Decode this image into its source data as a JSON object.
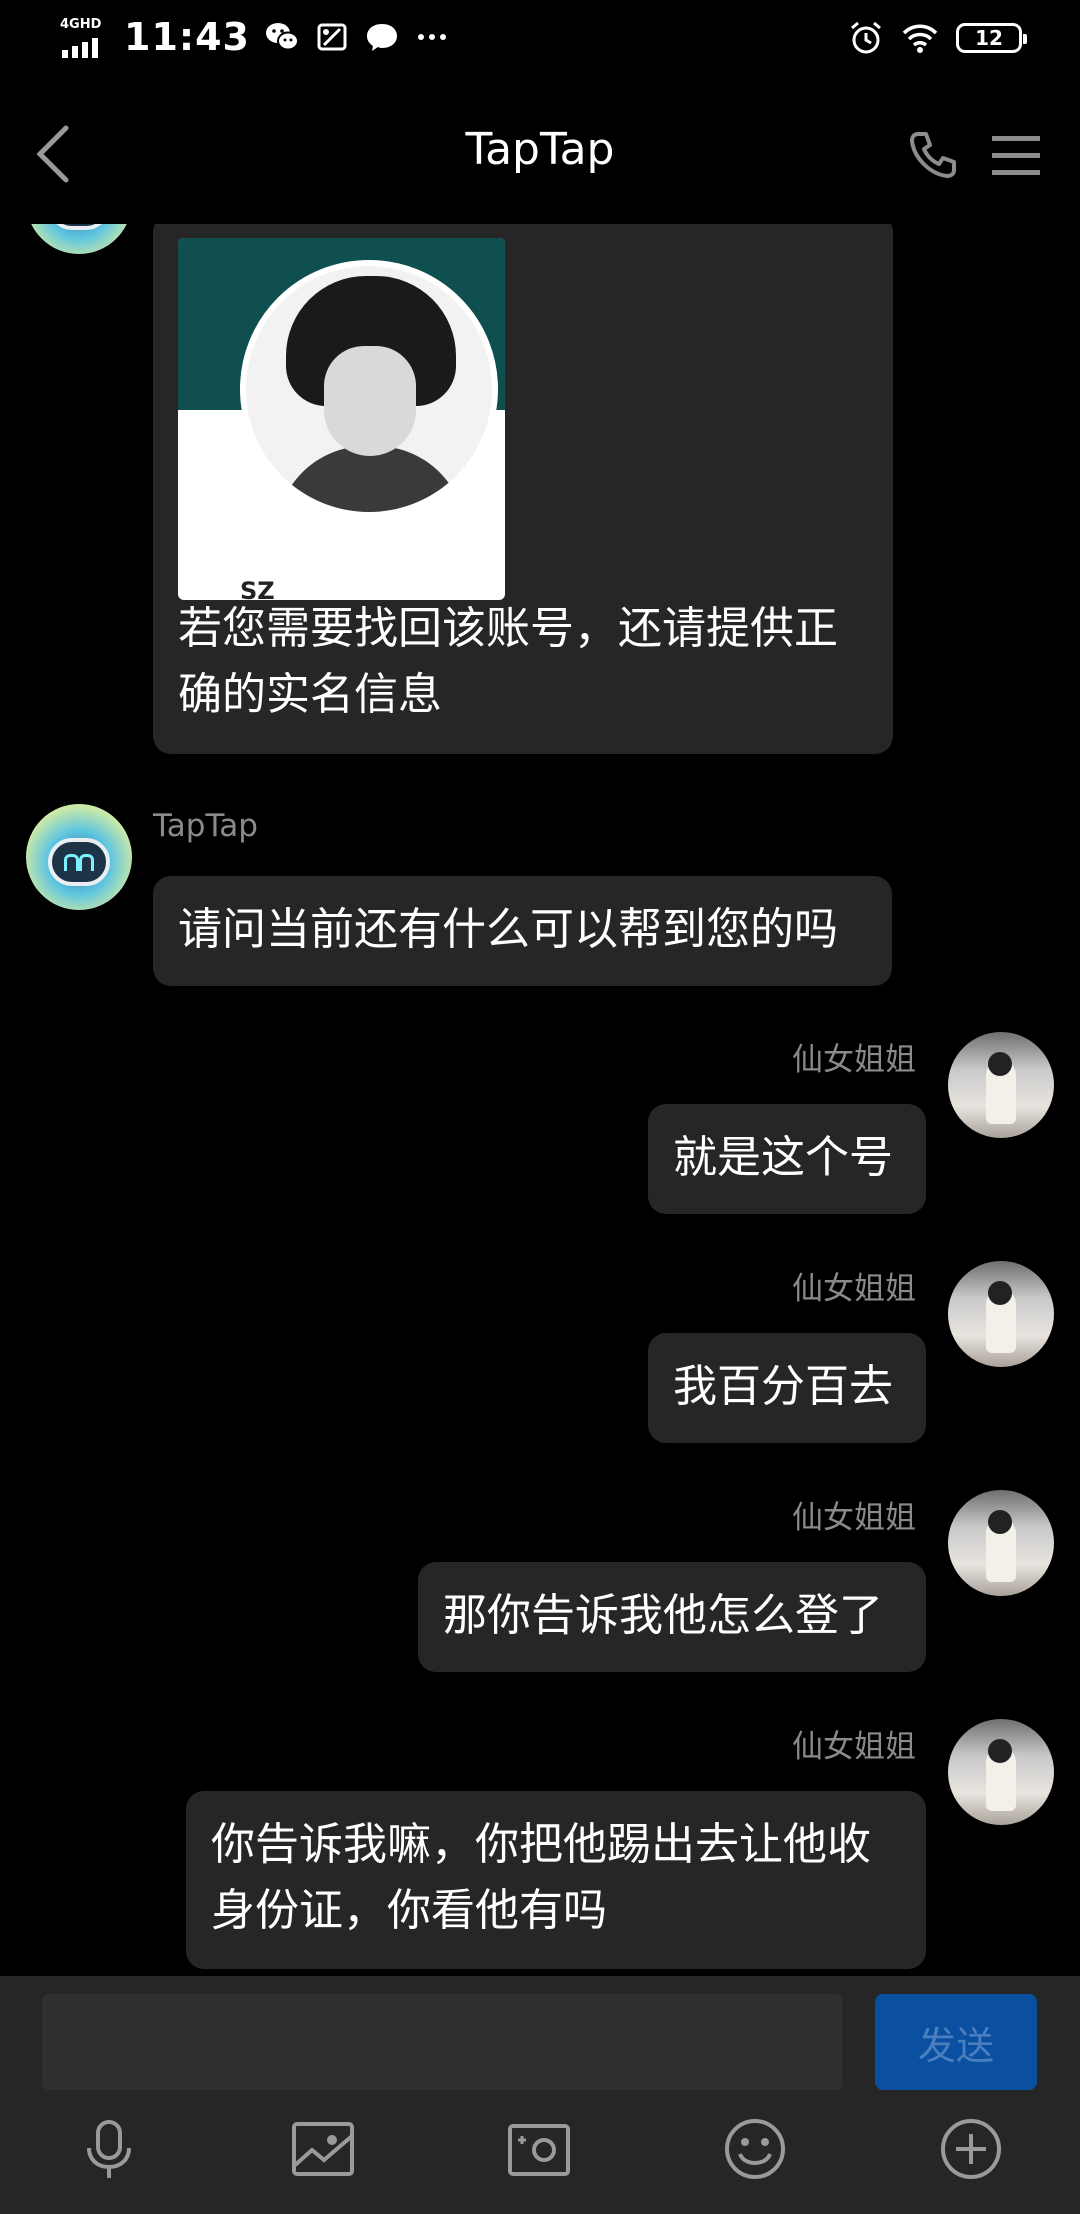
{
  "status_bar": {
    "network": "4GHD",
    "time": "11:43",
    "battery": "12",
    "icons": [
      "wechat-icon",
      "screenshot-icon",
      "message-icon",
      "more-dots-icon",
      "alarm-icon",
      "wifi-icon",
      "battery-icon"
    ]
  },
  "nav": {
    "title": "TapTap",
    "icons": [
      "back-arrow-icon",
      "phone-icon",
      "menu-icon"
    ]
  },
  "messages": [
    {
      "side": "left",
      "type": "image_text",
      "image_label": "SZ",
      "text_lines": [
        "若您需要找回该账号，还请提供正",
        "确的实名信息"
      ]
    },
    {
      "side": "left",
      "type": "text",
      "sender": "TapTap",
      "text_lines": [
        "请问当前还有什么可以帮到您的吗"
      ]
    },
    {
      "side": "right",
      "type": "text",
      "sender": "仙女姐姐",
      "text_lines": [
        "就是这个号"
      ]
    },
    {
      "side": "right",
      "type": "text",
      "sender": "仙女姐姐",
      "text_lines": [
        "我百分百去"
      ]
    },
    {
      "side": "right",
      "type": "text",
      "sender": "仙女姐姐",
      "text_lines": [
        "那你告诉我他怎么登了"
      ]
    },
    {
      "side": "right",
      "type": "text",
      "sender": "仙女姐姐",
      "text_lines": [
        "你告诉我嘛，你把他踢出去让他收",
        "身份证，你看他有吗"
      ]
    }
  ],
  "composer": {
    "input_value": "",
    "send_label": "发送",
    "toolbar_icons": [
      "microphone-icon",
      "image-icon",
      "camera-icon",
      "emoji-icon",
      "plus-icon"
    ]
  },
  "colors": {
    "background": "#000000",
    "bubble": "#262626",
    "sender_name": "#8a8a8a",
    "send_button": "#0b4fa1",
    "send_text": "#4a7fbf"
  }
}
